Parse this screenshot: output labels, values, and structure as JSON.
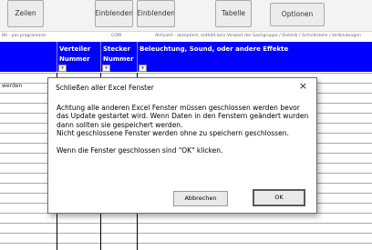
{
  "ribbon": {
    "buttons": [
      {
        "line1": "Zeilen"
      },
      {
        "line1": "Einblenden"
      },
      {
        "line1": "Einblenden"
      },
      {
        "line1": "Tabelle"
      },
      {
        "line1": "Optionen"
      }
    ]
  },
  "strip": {
    "left": "Bit - per programmer",
    "mid": "COM",
    "right": "Aktiviert - akzeptiert, enthält kein Vorwort der Sachgruppe / Elektrik / Schnittstelle / Verbindungen"
  },
  "header": {
    "col1": [
      "Verteiler",
      "Nummer"
    ],
    "col2": [
      "Stecker",
      "Nummer"
    ],
    "col3": "Beleuchtung, Sound, oder andere Effekte",
    "filter_symbol": "▾"
  },
  "grid": {
    "cell_werden": "werden"
  },
  "dialog": {
    "title": "Schließen aller Excel Fenster",
    "close_symbol": "×",
    "body_para1": "Achtung alle anderen Excel Fenster müssen geschlossen werden bevor das Update gestartet wird. Wenn Daten in den Fenstern geändert wurden dann sollten sie gespeichert werden.",
    "body_para2": "Nicht geschlossene Fenster werden ohne zu speichern geschlossen.",
    "body_para3": "Wenn die Fenster geschlossen sind \"OK\" klicken.",
    "cancel_label": "Abbrechen",
    "ok_label": "OK"
  },
  "colors": {
    "header_blue": "#0000ff",
    "header_text": "#ffffff"
  }
}
